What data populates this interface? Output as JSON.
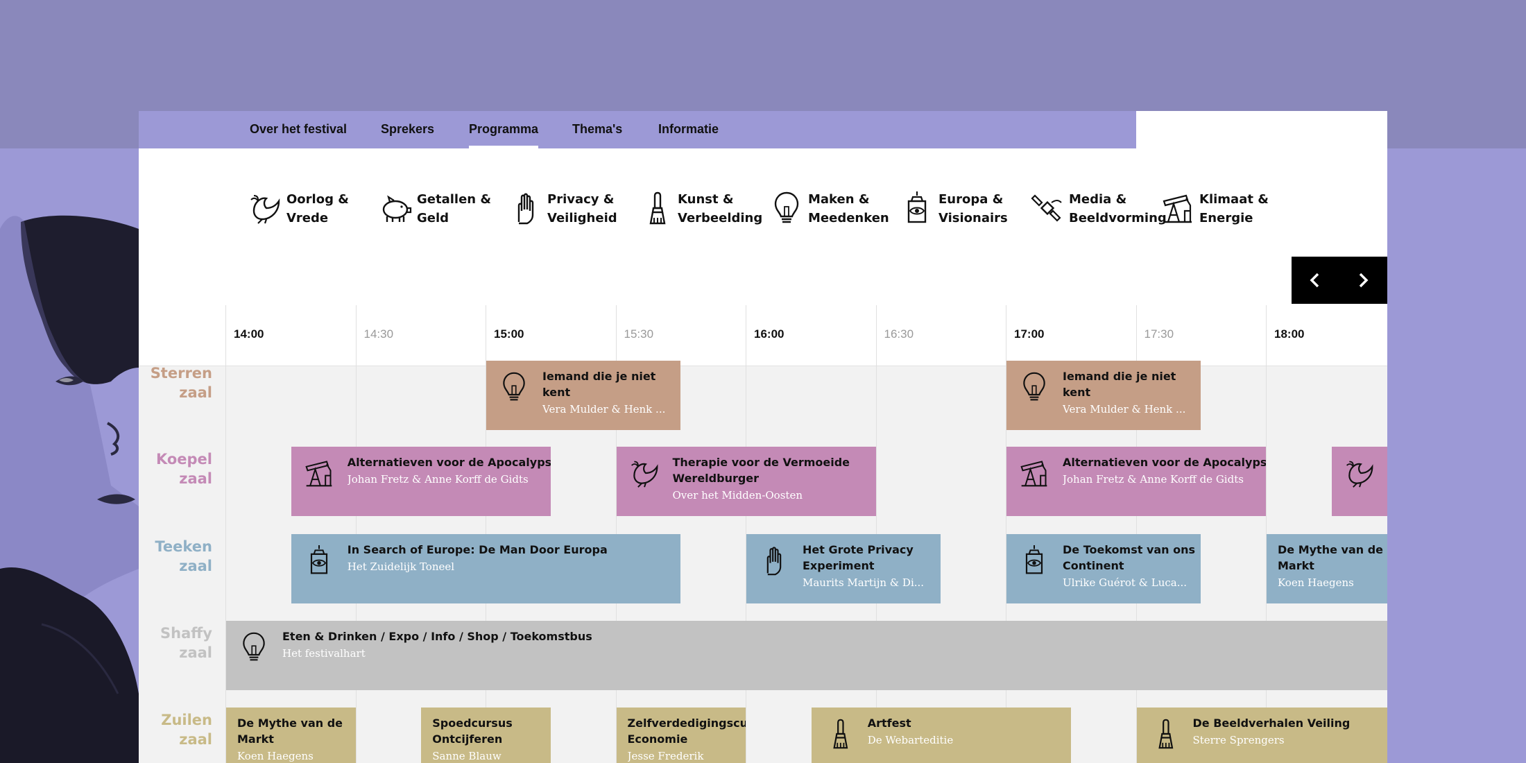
{
  "nav": {
    "items": [
      {
        "label": "Over het festival",
        "active": false
      },
      {
        "label": "Sprekers",
        "active": false
      },
      {
        "label": "Programma",
        "active": true
      },
      {
        "label": "Thema's",
        "active": false
      },
      {
        "label": "Informatie",
        "active": false
      }
    ]
  },
  "themes": [
    {
      "label": "Oorlog &\nVrede",
      "icon": "dove-icon"
    },
    {
      "label": "Getallen &\nGeld",
      "icon": "piggy-bank-icon"
    },
    {
      "label": "Privacy &\nVeiligheid",
      "icon": "hand-icon"
    },
    {
      "label": "Kunst &\nVerbeelding",
      "icon": "paintbrush-icon"
    },
    {
      "label": "Maken &\nMeedenken",
      "icon": "lightbulb-icon"
    },
    {
      "label": "Europa &\nVisionairs",
      "icon": "eye-tower-icon"
    },
    {
      "label": "Media &\nBeeldvorming",
      "icon": "satellite-icon"
    },
    {
      "label": "Klimaat &\nEnergie",
      "icon": "oil-pump-icon"
    }
  ],
  "timeline": {
    "times": [
      {
        "label": "14:00",
        "major": true
      },
      {
        "label": "14:30",
        "major": false
      },
      {
        "label": "15:00",
        "major": true
      },
      {
        "label": "15:30",
        "major": false
      },
      {
        "label": "16:00",
        "major": true
      },
      {
        "label": "16:30",
        "major": false
      },
      {
        "label": "17:00",
        "major": true
      },
      {
        "label": "17:30",
        "major": false
      },
      {
        "label": "18:00",
        "major": true
      }
    ]
  },
  "rooms": [
    {
      "label": "Sterren\nzaal",
      "color": "#c59e86"
    },
    {
      "label": "Koepel\nzaal",
      "color": "#c48ab6"
    },
    {
      "label": "Teeken\nzaal",
      "color": "#8fb0c6"
    },
    {
      "label": "Shaffy\nzaal",
      "color": "#c2c2c2"
    },
    {
      "label": "Zuilen\nzaal",
      "color": "#c8ba87"
    }
  ],
  "events": [
    {
      "room": 0,
      "start": "15:00",
      "end": "15:45",
      "title": "Iemand die je niet\nkent",
      "subtitle": "Vera Mulder & Henk ...",
      "icon": "lightbulb-icon",
      "color": "#c59e86"
    },
    {
      "room": 0,
      "start": "17:00",
      "end": "17:45",
      "title": "Iemand die je niet\nkent",
      "subtitle": "Vera Mulder & Henk ...",
      "icon": "lightbulb-icon",
      "color": "#c59e86"
    },
    {
      "room": 1,
      "start": "14:15",
      "end": "15:15",
      "title": "Alternatieven voor de Apocalyps",
      "subtitle": "Johan Fretz & Anne Korff de Gidts",
      "icon": "oil-pump-icon",
      "color": "#c48ab6"
    },
    {
      "room": 1,
      "start": "15:30",
      "end": "16:30",
      "title": "Therapie voor de Vermoeide\nWereldburger",
      "subtitle": "Over het Midden-Oosten",
      "icon": "dove-icon",
      "color": "#c48ab6"
    },
    {
      "room": 1,
      "start": "17:00",
      "end": "18:00",
      "title": "Alternatieven voor de Apocalyps",
      "subtitle": "Johan Fretz & Anne Korff de Gidts",
      "icon": "oil-pump-icon",
      "color": "#c48ab6"
    },
    {
      "room": 1,
      "start": "18:15",
      "end": "18:45",
      "title": "",
      "subtitle": "",
      "icon": "dove-icon",
      "color": "#c48ab6"
    },
    {
      "room": 2,
      "start": "14:15",
      "end": "15:45",
      "title": "In Search of Europe: De Man Door Europa",
      "subtitle": "Het Zuidelijk Toneel",
      "icon": "eye-tower-icon",
      "color": "#8fb0c6"
    },
    {
      "room": 2,
      "start": "16:00",
      "end": "16:45",
      "title": "Het Grote Privacy\nExperiment",
      "subtitle": "Maurits Martijn & Di...",
      "icon": "hand-icon",
      "color": "#8fb0c6"
    },
    {
      "room": 2,
      "start": "17:00",
      "end": "17:45",
      "title": "De Toekomst van ons\nContinent",
      "subtitle": "Ulrike Guérot & Luca...",
      "icon": "eye-tower-icon",
      "color": "#8fb0c6"
    },
    {
      "room": 2,
      "start": "18:00",
      "end": "18:45",
      "title": "De Mythe van de\nMarkt",
      "subtitle": "Koen Haegens",
      "icon": "",
      "color": "#8fb0c6"
    },
    {
      "room": 3,
      "start": "14:00",
      "end": "18:45",
      "title": "Eten & Drinken / Expo / Info / Shop / Toekomstbus",
      "subtitle": "Het festivalhart",
      "icon": "lightbulb-icon",
      "color": "#c2c2c2"
    },
    {
      "room": 4,
      "start": "14:00",
      "end": "14:30",
      "title": "De Mythe van de\nMarkt",
      "subtitle": "Koen Haegens",
      "icon": "",
      "color": "#c8ba87"
    },
    {
      "room": 4,
      "start": "14:45",
      "end": "15:15",
      "title": "Spoedcursus\nOntcijferen",
      "subtitle": "Sanne Blauw",
      "icon": "",
      "color": "#c8ba87"
    },
    {
      "room": 4,
      "start": "15:30",
      "end": "16:00",
      "title": "Zelfverdedigingscursus\nEconomie",
      "subtitle": "Jesse Frederik",
      "icon": "",
      "color": "#c8ba87"
    },
    {
      "room": 4,
      "start": "16:15",
      "end": "17:15",
      "title": "Artfest",
      "subtitle": "De Webarteditie",
      "icon": "paintbrush-icon",
      "color": "#c8ba87"
    },
    {
      "room": 4,
      "start": "17:30",
      "end": "18:45",
      "title": "De Beeldverhalen Veiling",
      "subtitle": "Sterre Sprengers",
      "icon": "paintbrush-icon",
      "color": "#c8ba87"
    }
  ]
}
